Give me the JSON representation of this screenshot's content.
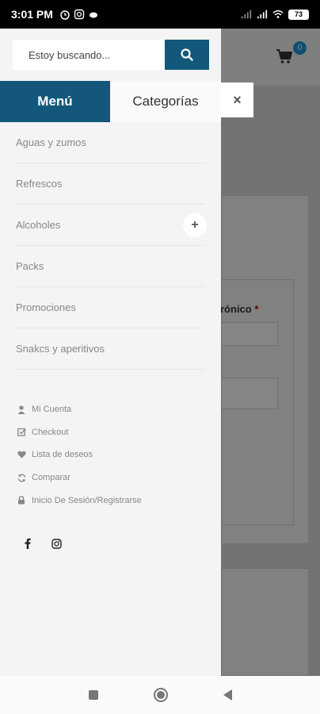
{
  "status_bar": {
    "time": "3:01 PM",
    "battery": "73"
  },
  "search": {
    "placeholder": "Estoy buscando..."
  },
  "tabs": [
    {
      "label": "Menú"
    },
    {
      "label": "Categorías"
    }
  ],
  "menu": {
    "items": [
      {
        "label": "Aguas y zumos"
      },
      {
        "label": "Refrescos"
      },
      {
        "label": "Alcoholes",
        "expand": "+"
      },
      {
        "label": "Packs"
      },
      {
        "label": "Promociones"
      },
      {
        "label": "Snakcs y aperitivos"
      }
    ]
  },
  "account": {
    "items": [
      {
        "label": "Mi Cuenta",
        "icon": "user-icon"
      },
      {
        "label": "Checkout",
        "icon": "checkbox-icon"
      },
      {
        "label": "Lista de deseos",
        "icon": "heart-icon"
      },
      {
        "label": "Comparar",
        "icon": "refresh-icon"
      },
      {
        "label": "Inicio De Sesión/Registrarse",
        "icon": "lock-icon"
      }
    ]
  },
  "social": [
    {
      "icon": "facebook-icon"
    },
    {
      "icon": "instagram-icon"
    }
  ],
  "background": {
    "cart_count": "0",
    "field_label": "rónico",
    "required_mark": "*",
    "close_symbol": "×"
  },
  "colors": {
    "primary": "#13587a",
    "badge": "#1a9ad6"
  }
}
